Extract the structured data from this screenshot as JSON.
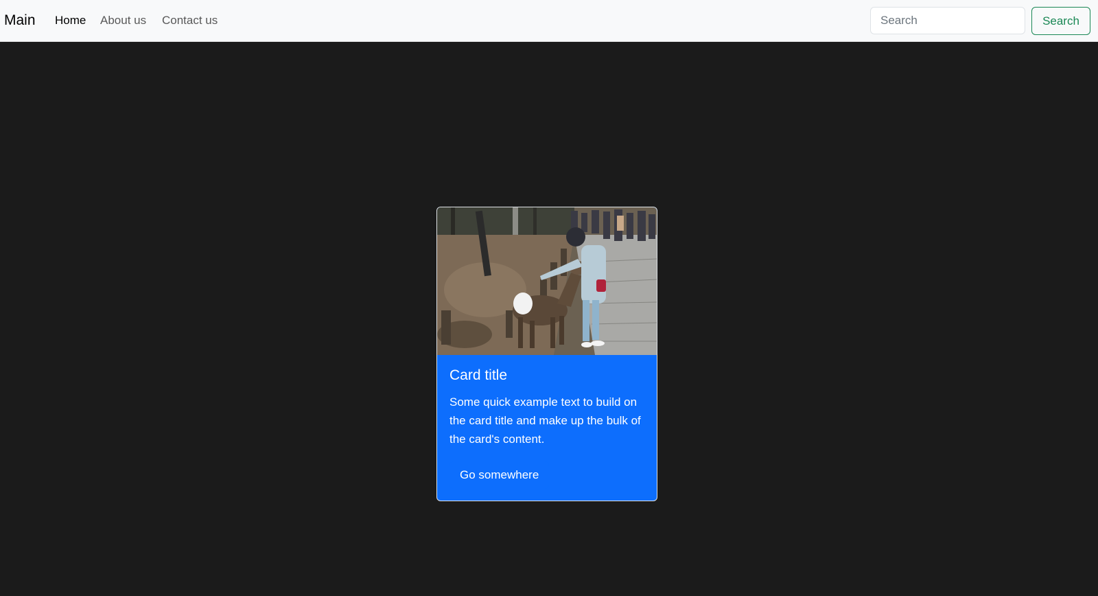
{
  "navbar": {
    "brand": "Main",
    "links": [
      {
        "label": "Home",
        "active": true
      },
      {
        "label": "About us",
        "active": false
      },
      {
        "label": "Contact us",
        "active": false
      }
    ],
    "search": {
      "placeholder": "Search",
      "value": "",
      "button_label": "Search"
    }
  },
  "card": {
    "image_alt": "",
    "title": "Card title",
    "text": "Some quick example text to build on the card title and make up the bulk of the card's content.",
    "button_label": "Go somewhere"
  },
  "colors": {
    "page_background": "#1b1b1b",
    "navbar_background": "#f8f9fa",
    "card_background": "#0d6efd",
    "search_button": "#198754"
  }
}
